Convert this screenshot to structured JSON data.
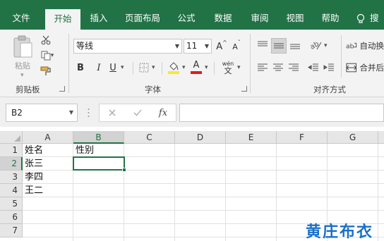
{
  "tabs": [
    "文件",
    "开始",
    "插入",
    "页面布局",
    "公式",
    "数据",
    "审阅",
    "视图",
    "帮助",
    "搜"
  ],
  "ribbon": {
    "clipboard": {
      "paste_label": "粘贴",
      "group_label": "剪贴板"
    },
    "font": {
      "font_name": "等线",
      "font_size": "11",
      "bold": "B",
      "italic": "I",
      "underline": "U",
      "grow": "A",
      "shrink": "A",
      "phonetic_top": "wén",
      "phonetic_bottom": "文",
      "highlight_color": "#f7e92f",
      "font_color": "#e11b1b",
      "group_label": "字体"
    },
    "alignment": {
      "wrap_label": "自动换",
      "merge_label": "合并后",
      "group_label": "对齐方式"
    }
  },
  "formula_bar": {
    "name_box": "B2",
    "fx": "fx",
    "formula": ""
  },
  "sheet": {
    "columns": [
      "A",
      "B",
      "C",
      "D",
      "E",
      "F",
      "G"
    ],
    "rows": [
      "1",
      "2",
      "3",
      "4",
      "5",
      "6",
      "7"
    ],
    "cells": {
      "A1": "姓名",
      "B1": "性别",
      "A2": "张三",
      "A3": "李四",
      "A4": "王二"
    },
    "selected": "B2"
  },
  "watermark": "黄庄布衣",
  "colors": {
    "accent": "#217346"
  }
}
